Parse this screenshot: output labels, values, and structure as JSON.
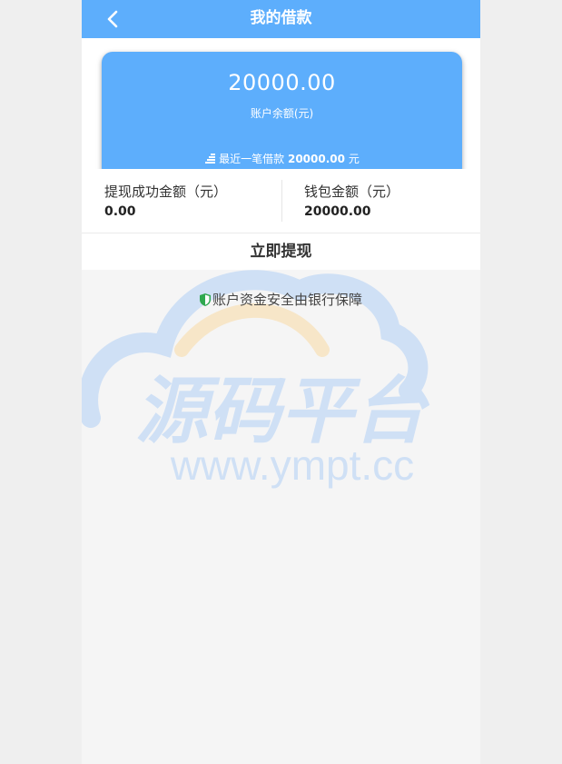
{
  "header": {
    "title": "我的借款"
  },
  "card": {
    "balance": "20000.00",
    "balance_label": "账户余额(元)",
    "recent_prefix": "最近一笔借款",
    "recent_amount": "20000.00",
    "recent_unit": "元"
  },
  "stats": [
    {
      "label": "提现成功金额（元）",
      "value": "0.00"
    },
    {
      "label": "钱包金额（元）",
      "value": "20000.00"
    }
  ],
  "withdraw": {
    "label": "立即提现"
  },
  "safety": {
    "text": "账户资金安全由银行保障"
  },
  "watermark": {
    "brand": "源码平台",
    "url": "www.ympt.cc"
  },
  "colors": {
    "primary": "#5daefc",
    "shield": "#2fa84f"
  },
  "icons": {
    "back": "chevron-left-icon",
    "recent": "coins-icon",
    "safety": "shield-icon"
  }
}
